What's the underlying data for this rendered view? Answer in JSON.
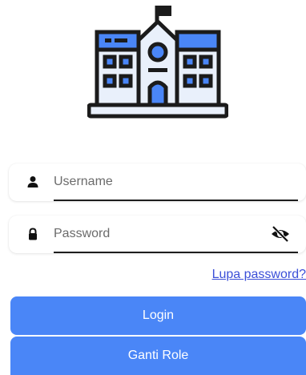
{
  "logo": {
    "icon": "school-building-icon",
    "colors": {
      "outline": "#1b1b1b",
      "fill": "#e9f0fb",
      "accent": "#4a86f7"
    }
  },
  "form": {
    "username": {
      "icon": "user-icon",
      "placeholder": "Username",
      "value": ""
    },
    "password": {
      "icon": "lock-icon",
      "placeholder": "Password",
      "value": "",
      "toggle_icon": "eye-off-icon"
    },
    "forgot_label": "Lupa password?"
  },
  "buttons": {
    "login_label": "Login",
    "switch_role_label": "Ganti Role"
  },
  "colors": {
    "primary": "#4a86f7",
    "link": "#3b4fd8"
  }
}
